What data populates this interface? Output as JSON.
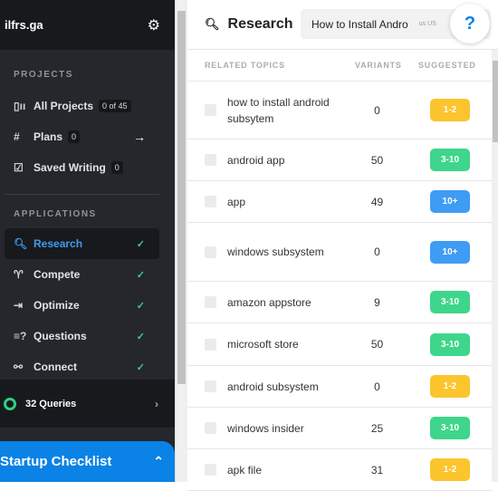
{
  "sidebar": {
    "brand": "ilfrs.ga",
    "projects_heading": "PROJECTS",
    "projects": [
      {
        "label": "All Projects",
        "badge": "0 of 45",
        "icon": "columns-icon"
      },
      {
        "label": "Plans",
        "badge": "0",
        "icon": "hash-icon"
      },
      {
        "label": "Saved Writing",
        "badge": "0",
        "icon": "edit-icon"
      }
    ],
    "applications_heading": "APPLICATIONS",
    "applications": [
      {
        "label": "Research",
        "icon": "search-plus-icon",
        "active": true
      },
      {
        "label": "Compete",
        "icon": "trophy-icon"
      },
      {
        "label": "Optimize",
        "icon": "login-icon"
      },
      {
        "label": "Questions",
        "icon": "question-list-icon"
      },
      {
        "label": "Connect",
        "icon": "link-icon"
      }
    ],
    "queries": "32 Queries",
    "checklist": "Startup Checklist"
  },
  "main": {
    "title": "Research",
    "search_value": "How to Install Andro",
    "locale": "us US",
    "help": "?",
    "columns": [
      "RELATED TOPICS",
      "VARIANTS",
      "SUGGESTED"
    ],
    "rows": [
      {
        "topic": "how to install android subsytem",
        "variants": "0",
        "suggested": "1-2"
      },
      {
        "topic": "android app",
        "variants": "50",
        "suggested": "3-10"
      },
      {
        "topic": "app",
        "variants": "49",
        "suggested": "10+"
      },
      {
        "topic": "windows subsystem",
        "variants": "0",
        "suggested": "10+"
      },
      {
        "topic": "amazon appstore",
        "variants": "9",
        "suggested": "3-10"
      },
      {
        "topic": "microsoft store",
        "variants": "50",
        "suggested": "3-10"
      },
      {
        "topic": "android subsystem",
        "variants": "0",
        "suggested": "1-2"
      },
      {
        "topic": "windows insider",
        "variants": "25",
        "suggested": "3-10"
      },
      {
        "topic": "apk file",
        "variants": "31",
        "suggested": "1-2"
      }
    ]
  },
  "colors": {
    "1-2": "#fcc42d",
    "3-10": "#3ed68a",
    "10+": "#3f9cf5",
    "accent": "#0a82e6"
  }
}
